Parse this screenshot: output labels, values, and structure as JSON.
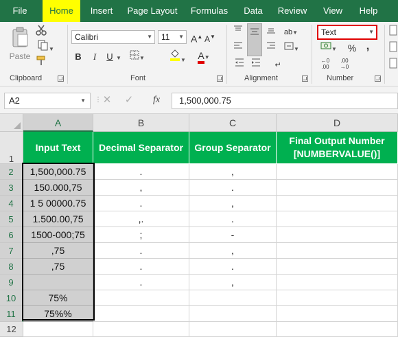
{
  "menu": {
    "tabs": [
      "File",
      "Home",
      "Insert",
      "Page Layout",
      "Formulas",
      "Data",
      "Review",
      "View",
      "Help"
    ],
    "active_index": 1
  },
  "ribbon": {
    "clipboard": {
      "paste_label": "Paste",
      "group_label": "Clipboard"
    },
    "font": {
      "font_name": "Calibri",
      "font_size": "11",
      "bold": "B",
      "italic": "I",
      "underline": "U",
      "grow_font": "A",
      "shrink_font": "A",
      "font_color_glyph": "A",
      "group_label": "Font"
    },
    "alignment": {
      "group_label": "Alignment"
    },
    "number": {
      "format": "Text",
      "percent": "%",
      "comma": ",",
      "group_label": "Number"
    }
  },
  "formula_bar": {
    "name_box": "A2",
    "fx": "fx",
    "value": "1,500,000.75"
  },
  "columns": [
    "A",
    "B",
    "C",
    "D"
  ],
  "rows": [
    "1",
    "2",
    "3",
    "4",
    "5",
    "6",
    "7",
    "8",
    "9",
    "10",
    "11",
    "12"
  ],
  "table": {
    "headers": [
      "Input Text",
      "Decimal Separator",
      "Group Separator",
      "Final Output Number [NUMBERVALUE()]"
    ],
    "data": [
      [
        "1,500,000.75",
        ".",
        ",",
        ""
      ],
      [
        "150.000,75",
        ",",
        ".",
        ""
      ],
      [
        "1 5 00000.75",
        ".",
        ",",
        ""
      ],
      [
        "1.500.00,75",
        ",.",
        ".",
        ""
      ],
      [
        "1500-000;75",
        ";",
        "-",
        ""
      ],
      [
        ",75",
        ".",
        ",",
        ""
      ],
      [
        ",75",
        ".",
        ".",
        ""
      ],
      [
        "",
        ".",
        ",",
        ""
      ],
      [
        "75%",
        "",
        "",
        ""
      ],
      [
        "75%%",
        "",
        "",
        ""
      ]
    ]
  },
  "colors": {
    "ribbon_green": "#217346",
    "header_fill": "#00b050",
    "input_fill": "#d0d0d0",
    "highlight": "#ffff00",
    "callout": "#e00000"
  }
}
